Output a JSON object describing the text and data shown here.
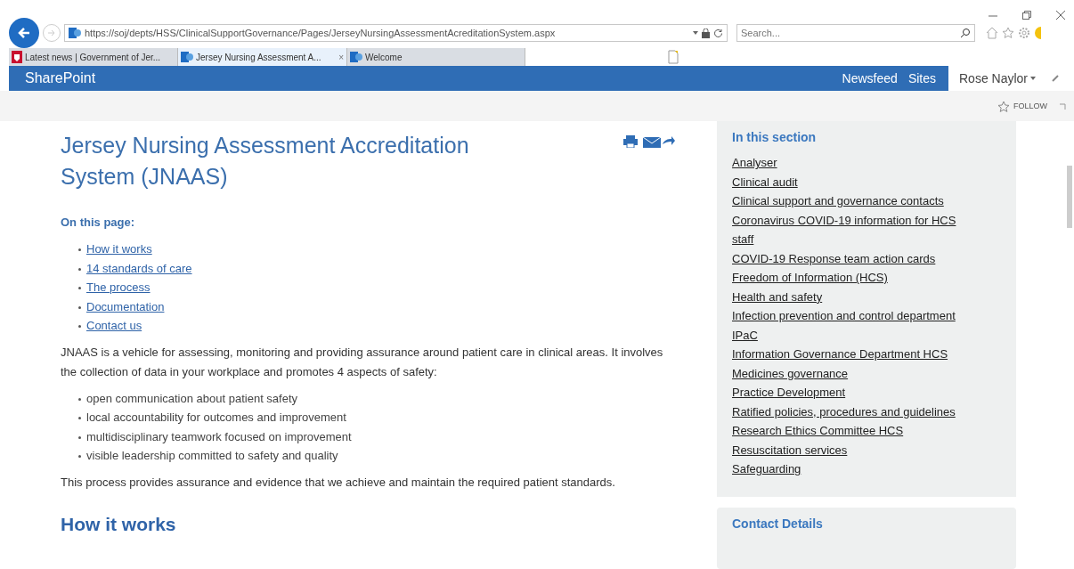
{
  "browser": {
    "address": "https://soj/depts/HSS/ClinicalSupportGovernance/Pages/JerseyNursingAssessmentAcreditationSystem.aspx",
    "search": {
      "placeholder": "Search..."
    },
    "tabs": [
      {
        "label": "Latest news | Government of Jer...",
        "kind": "crest",
        "selected": false
      },
      {
        "label": "Jersey Nursing Assessment A...",
        "kind": "sharepoint",
        "selected": true,
        "close": "×"
      },
      {
        "label": "Welcome",
        "kind": "sharepoint",
        "selected": false
      }
    ]
  },
  "suite_bar": {
    "brand": "SharePoint",
    "nav": [
      "Newsfeed",
      "Sites"
    ],
    "user": "Rose Naylor"
  },
  "follow": "FOLLOW",
  "page": {
    "title": "Jersey Nursing Assessment Accreditation System (JNAAS)",
    "toc_heading": "On this page:",
    "toc": [
      "How it works",
      "14 standards of care",
      "The process",
      "Documentation",
      "Contact us"
    ],
    "intro": "JNAAS is a vehicle for assessing, monitoring and providing assurance around patient care in clinical areas. It involves the collection of data in your workplace and promotes 4 aspects of safety:",
    "aspects": [
      "open communication about patient safety",
      "local accountability for outcomes and improvement",
      "multidisciplinary teamwork focused on improvement",
      "visible leadership committed to safety and quality"
    ],
    "assurance": "This process provides assurance and evidence that we achieve and maintain the required patient standards.",
    "section_heading": "How it works"
  },
  "sidebar": {
    "heading": "In this section",
    "links": [
      "Analyser",
      "Clinical audit",
      "Clinical support and governance contacts",
      "Coronavirus COVID-19 information for HCS staff",
      "COVID-19 Response team action cards",
      "Freedom of Information (HCS)",
      "Health and safety",
      "Infection prevention and control department",
      "IPaC",
      "Information Governance Department HCS",
      "Medicines governance",
      "Practice Development",
      "Ratified policies, procedures and guidelines",
      "Research Ethics Committee HCS",
      "Resuscitation services",
      "Safeguarding"
    ],
    "contact_heading": "Contact Details"
  }
}
